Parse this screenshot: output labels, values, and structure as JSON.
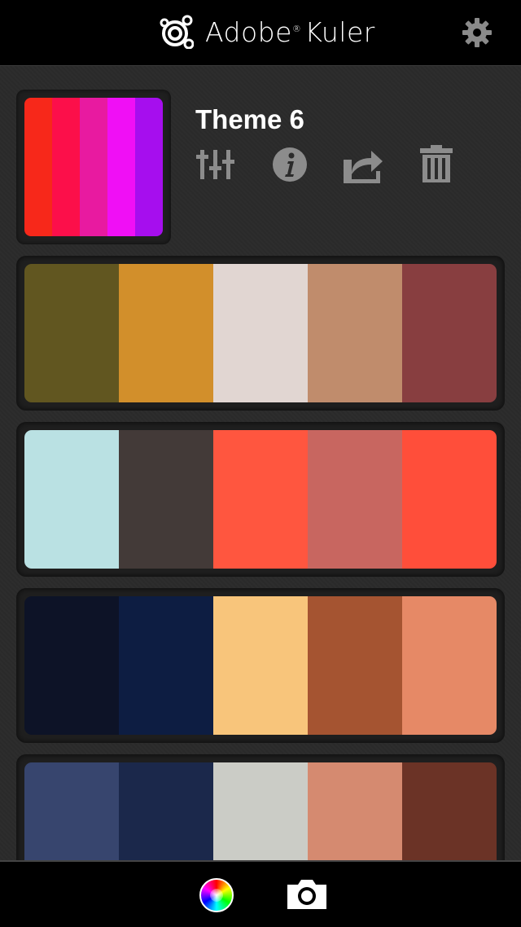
{
  "header": {
    "app_name": "Adobe",
    "registered_mark": "®",
    "app_subname": "Kuler",
    "settings_icon": "gear-icon"
  },
  "selected_theme": {
    "title": "Theme 6",
    "colors": [
      "#F7281A",
      "#FC0F4A",
      "#E81AA0",
      "#F00FF5",
      "#A60EEE"
    ],
    "actions": [
      "sliders-icon",
      "info-icon",
      "share-icon",
      "trash-icon"
    ]
  },
  "themes": [
    {
      "colors": [
        "#615620",
        "#D28F2B",
        "#E1D6D2",
        "#C08C6C",
        "#883E40"
      ]
    },
    {
      "colors": [
        "#BAE1E3",
        "#433A38",
        "#FF563F",
        "#C86660",
        "#FF4E3A"
      ]
    },
    {
      "colors": [
        "#0D1327",
        "#0D1D42",
        "#F8C57B",
        "#A55431",
        "#E68966"
      ]
    },
    {
      "colors": [
        "#37456E",
        "#1B284B",
        "#CBCCC6",
        "#D58A70",
        "#6B3326"
      ]
    }
  ],
  "tabbar": {
    "items": [
      "color-wheel-icon",
      "camera-icon"
    ]
  }
}
